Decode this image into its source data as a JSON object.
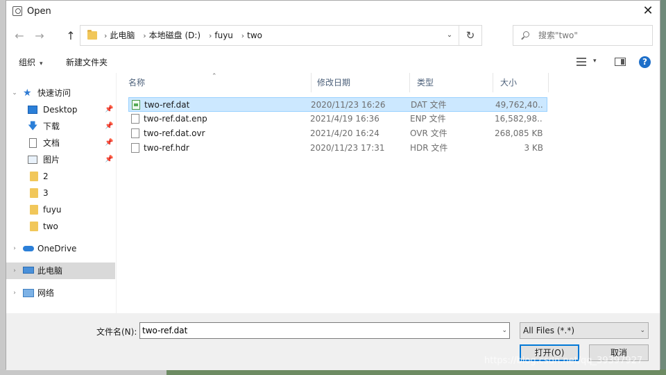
{
  "window": {
    "title": "Open",
    "close_glyph": "✕"
  },
  "navigation": {
    "back_glyph": "←",
    "forward_glyph": "→",
    "up_glyph": "↑",
    "breadcrumbs": [
      "此电脑",
      "本地磁盘 (D:)",
      "fuyu",
      "two"
    ],
    "separator_glyph": "›",
    "dropdown_glyph": "⌄",
    "refresh_glyph": "↻"
  },
  "search": {
    "placeholder": "搜索\"two\""
  },
  "toolbar": {
    "organize_label": "组织",
    "new_folder_label": "新建文件夹",
    "caret_glyph": "▾",
    "help_glyph": "?"
  },
  "nav_pane": {
    "items": [
      {
        "label": "快速访问",
        "icon": "star-icon",
        "expander": "⌄"
      },
      {
        "label": "Desktop",
        "icon": "desktop-icon",
        "pinned": true
      },
      {
        "label": "下载",
        "icon": "download-icon",
        "pinned": true
      },
      {
        "label": "文档",
        "icon": "document-icon",
        "pinned": true
      },
      {
        "label": "图片",
        "icon": "pictures-icon",
        "pinned": true
      },
      {
        "label": "2",
        "icon": "folder-icon"
      },
      {
        "label": "3",
        "icon": "folder-icon"
      },
      {
        "label": "fuyu",
        "icon": "folder-icon"
      },
      {
        "label": "two",
        "icon": "folder-icon"
      },
      {
        "label": "OneDrive",
        "icon": "cloud-icon",
        "expander": "›"
      },
      {
        "label": "此电脑",
        "icon": "computer-icon",
        "expander": "›",
        "selected": true
      },
      {
        "label": "网络",
        "icon": "network-icon",
        "expander": "›"
      }
    ],
    "pin_glyph": "📌",
    "download_glyph": "🡇",
    "star_glyph": "★"
  },
  "file_list": {
    "columns": [
      "名称",
      "修改日期",
      "类型",
      "大小"
    ],
    "sort_glyph": "⌃",
    "rows": [
      {
        "name": "two-ref.dat",
        "date": "2020/11/23 16:26",
        "type": "DAT 文件",
        "size": "49,762,40...",
        "icon": "data-file-icon",
        "selected": true
      },
      {
        "name": "two-ref.dat.enp",
        "date": "2021/4/19 16:36",
        "type": "ENP 文件",
        "size": "16,582,98...",
        "icon": "file-icon"
      },
      {
        "name": "two-ref.dat.ovr",
        "date": "2021/4/20 16:24",
        "type": "OVR 文件",
        "size": "268,085 KB",
        "icon": "file-icon"
      },
      {
        "name": "two-ref.hdr",
        "date": "2020/11/23 17:31",
        "type": "HDR 文件",
        "size": "3 KB",
        "icon": "file-icon"
      }
    ]
  },
  "bottom": {
    "filename_label": "文件名(N):",
    "filename_value": "two-ref.dat",
    "filter_value": "All Files (*.*)",
    "open_label": "打开(O)",
    "cancel_label": "取消"
  },
  "watermark": "https://blog.csdn.net/qq_39397927"
}
